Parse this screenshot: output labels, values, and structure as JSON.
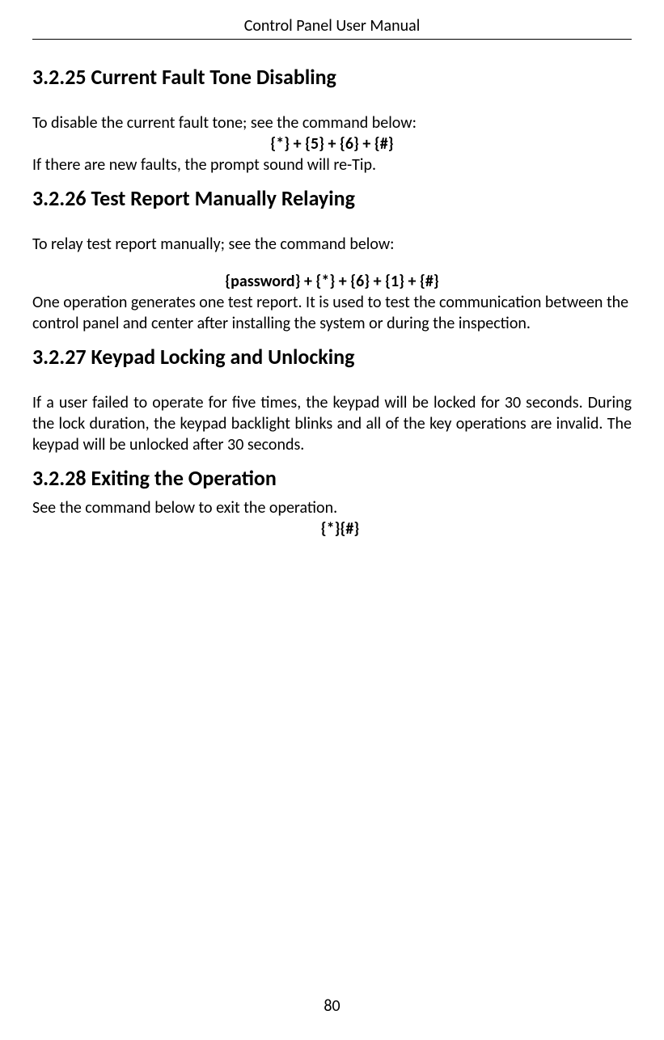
{
  "header": {
    "title": "Control Panel User Manual"
  },
  "sections": {
    "s1": {
      "heading": "3.2.25 Current Fault Tone Disabling",
      "intro": "To disable the current fault tone; see the command below:",
      "command": "{*} + {5} + {6} + {#}",
      "note": "If there are new faults, the prompt sound will re-Tip."
    },
    "s2": {
      "heading": "3.2.26 Test Report Manually Relaying",
      "intro": "To relay test report manually; see the command below:",
      "command": "{password}    + {*} + {6} + {1} + {#}",
      "note": "One operation generates one test report. It is used to test the communication between the control panel and center after installing the system or during the inspection."
    },
    "s3": {
      "heading": "3.2.27 Keypad Locking and Unlocking",
      "body": "If a user failed to operate for five times, the keypad will be locked for 30 seconds. During the lock duration, the keypad backlight blinks and all of the key operations are invalid. The keypad will be unlocked after 30 seconds."
    },
    "s4": {
      "heading": "3.2.28 Exiting the Operation",
      "intro": "See the command below to exit the operation.",
      "command": "{*}{#}"
    }
  },
  "footer": {
    "page_number": "80"
  }
}
